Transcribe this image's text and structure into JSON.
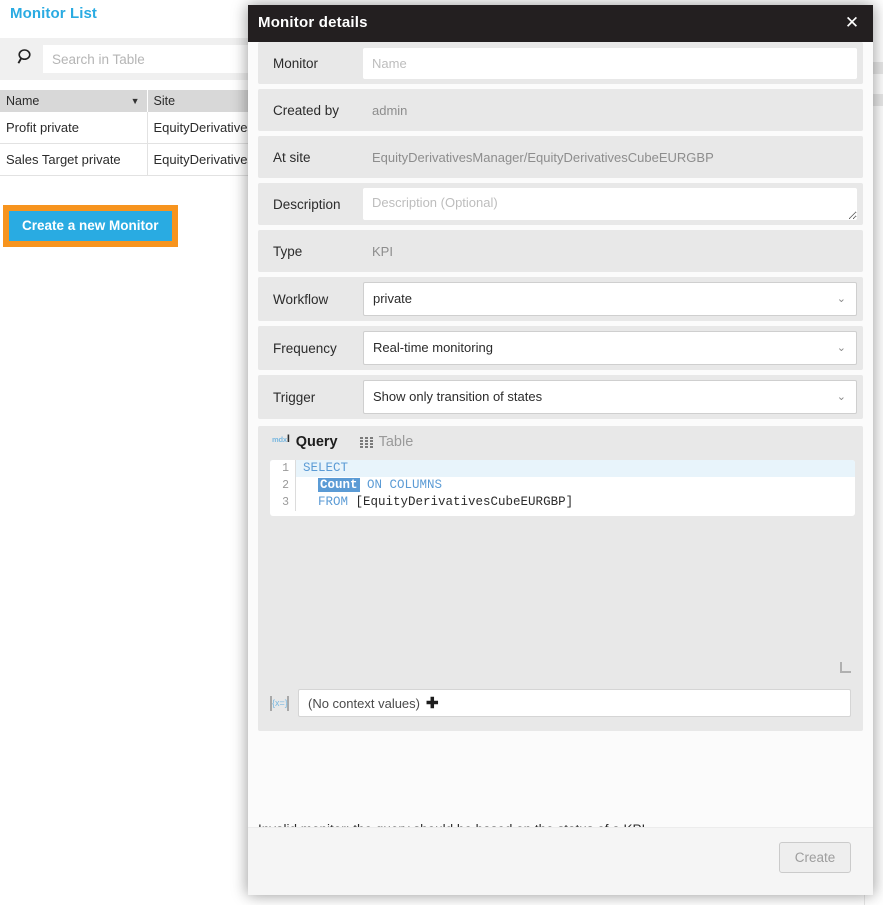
{
  "background": {
    "title": "Monitor List",
    "search": {
      "placeholder": "Search in Table",
      "value": "",
      "icon": "search-icon"
    },
    "table": {
      "columns": [
        "Name",
        "Site"
      ],
      "sort_caret": "▼",
      "rows": [
        {
          "name": "Profit private",
          "site": "EquityDerivativesM"
        },
        {
          "name": "Sales Target private",
          "site": "EquityDerivativesM"
        }
      ]
    },
    "create_monitor_label": "Create a new Monitor",
    "focus_ring_color": "#f7941e",
    "accent_color": "#29abe2"
  },
  "modal": {
    "title": "Monitor details",
    "close_icon": "✕",
    "fields": [
      {
        "label": "Monitor",
        "placeholder": "Name",
        "value": "",
        "kind": "input",
        "readonly": false
      },
      {
        "label": "Created by",
        "placeholder": "",
        "value": "admin",
        "kind": "input",
        "readonly": true
      },
      {
        "label": "At site",
        "placeholder": "",
        "value": "EquityDerivativesManager/EquityDerivativesCubeEURGBP",
        "kind": "input",
        "readonly": true
      },
      {
        "label": "Description",
        "placeholder": "Description (Optional)",
        "value": "",
        "kind": "textarea",
        "readonly": false
      },
      {
        "label": "Type",
        "placeholder": "",
        "value": "KPI",
        "kind": "input",
        "readonly": true
      },
      {
        "label": "Workflow",
        "value": "private",
        "kind": "select"
      },
      {
        "label": "Frequency",
        "value": "Real-time monitoring",
        "kind": "select"
      },
      {
        "label": "Trigger",
        "value": "Show only transition of states",
        "kind": "select"
      }
    ],
    "select_chevron": "⌄",
    "query_panel": {
      "tabs": [
        {
          "label": "Query",
          "icon": "mdx-cursor-icon",
          "active": true
        },
        {
          "label": "Table",
          "icon": "table-grid-icon",
          "active": false
        }
      ],
      "editor": {
        "lines": [
          {
            "number": "1",
            "highlighted": true,
            "tokens": [
              {
                "text": "SELECT",
                "type": "keyword"
              }
            ]
          },
          {
            "number": "2",
            "highlighted": false,
            "tokens": [
              {
                "text": "  ",
                "type": "plain"
              },
              {
                "text": "Count",
                "type": "selection"
              },
              {
                "text": " ",
                "type": "plain"
              },
              {
                "text": "ON COLUMNS",
                "type": "keyword"
              }
            ]
          },
          {
            "number": "3",
            "highlighted": false,
            "tokens": [
              {
                "text": "  ",
                "type": "plain"
              },
              {
                "text": "FROM",
                "type": "keyword"
              },
              {
                "text": " [EquityDerivativesCubeEURGBP]",
                "type": "plain"
              }
            ]
          }
        ],
        "keyword_color": "#5b9bd5",
        "selection_bg": "#5b9bd5",
        "active_line_bg": "#e8f4fb"
      },
      "context": {
        "icon": "{x=}",
        "label": "(No context values)",
        "add_icon": "✚"
      }
    },
    "error_message": "Invalid monitor: the query should be based on the status of a KPI.",
    "footer": {
      "create_label": "Create",
      "create_disabled": true
    }
  }
}
